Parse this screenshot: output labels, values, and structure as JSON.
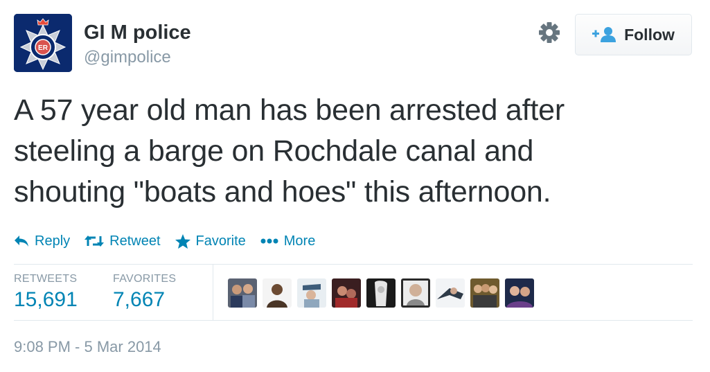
{
  "user": {
    "display_name": "GI M police",
    "handle": "@gimpolice",
    "avatar_icon": "police-badge-icon",
    "avatar_bg": "#0b2a6e"
  },
  "follow_button": {
    "label": "Follow",
    "icon": "add-user-icon"
  },
  "settings_icon": "gear-icon",
  "tweet": {
    "lines": [
      "A 57 year old man has been arrested after",
      "steeling a barge on Rochdale canal and",
      "shouting \"boats and hoes\" this afternoon."
    ]
  },
  "actions": {
    "reply": {
      "label": "Reply",
      "icon": "reply-icon"
    },
    "retweet": {
      "label": "Retweet",
      "icon": "retweet-icon"
    },
    "favorite": {
      "label": "Favorite",
      "icon": "star-icon"
    },
    "more": {
      "label": "More",
      "icon": "more-dots-icon"
    }
  },
  "stats": {
    "retweets_label": "RETWEETS",
    "retweets_value": "15,691",
    "favorites_label": "FAVORITES",
    "favorites_value": "7,667"
  },
  "faces_count": 9,
  "timestamp": "9:08 PM - 5 Mar 2014",
  "colors": {
    "link_blue": "#0084b4",
    "text": "#292f33",
    "muted": "#8899a6",
    "border": "#e1e8ed"
  }
}
